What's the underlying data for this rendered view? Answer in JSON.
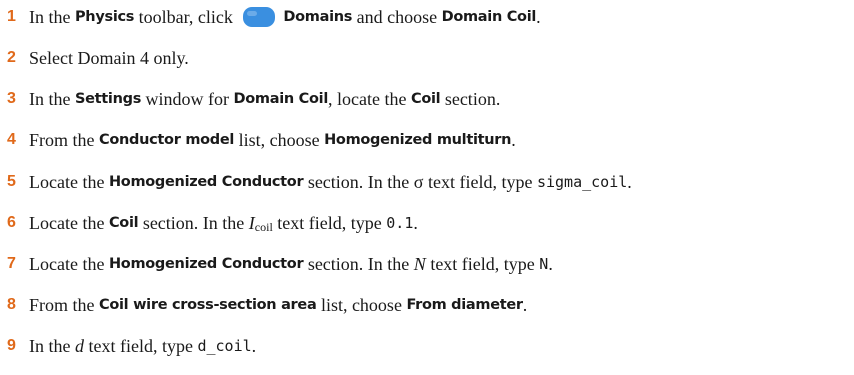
{
  "steps": [
    {
      "number": "1",
      "t1": "In the ",
      "b1": "Physics",
      "t2": " toolbar, click ",
      "icon": "domains-icon",
      "b2": "Domains",
      "t3": " and choose ",
      "b3": "Domain Coil",
      "t4": "."
    },
    {
      "number": "2",
      "t1": "Select Domain 4 only."
    },
    {
      "number": "3",
      "t1": "In the ",
      "b1": "Settings",
      "t2": " window for ",
      "b2": "Domain Coil",
      "t3": ", locate the ",
      "b3": "Coil",
      "t4": " section."
    },
    {
      "number": "4",
      "t1": "From the ",
      "b1": "Conductor model",
      "t2": " list, choose ",
      "b2": "Homogenized multiturn",
      "t3": "."
    },
    {
      "number": "5",
      "t1": "Locate the ",
      "b1": "Homogenized Conductor",
      "t2": " section. In the σ text field, type ",
      "code": "sigma_coil",
      "t3": "."
    },
    {
      "number": "6",
      "t1": "Locate the ",
      "b1": "Coil",
      "t2": " section. In the ",
      "var": "I",
      "sub": "coil",
      "t3": " text field, type ",
      "code": "0.1",
      "t4": "."
    },
    {
      "number": "7",
      "t1": "Locate the ",
      "b1": "Homogenized Conductor",
      "t2": " section. In the ",
      "var": "N",
      "t3": " text field, type ",
      "code": "N",
      "t4": "."
    },
    {
      "number": "8",
      "t1": "From the ",
      "b1": "Coil wire cross-section area",
      "t2": " list, choose ",
      "b2": "From diameter",
      "t3": "."
    },
    {
      "number": "9",
      "t1": "In the ",
      "var": "d",
      "t2": " text field, type ",
      "code": "d_coil",
      "t3": "."
    }
  ],
  "colors": {
    "step_number": "#e0691a",
    "domains_icon": "#3a8fe0",
    "text": "#1a1a1a"
  }
}
